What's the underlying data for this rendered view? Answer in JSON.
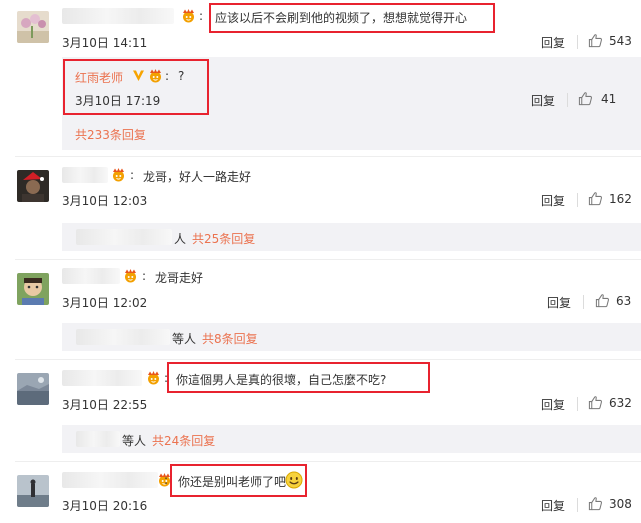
{
  "comments": [
    {
      "text": "应该以后不会刷到他的视频了，想想就觉得开心",
      "date": "3月10日 14:11",
      "reply_label": "回复",
      "likes": "543",
      "replies": [
        {
          "username": "红雨老师",
          "text": "?",
          "date": "3月10日 17:19",
          "reply_label": "回复",
          "likes": "41"
        }
      ],
      "more_replies": "共233条回复"
    },
    {
      "text": "龙哥，好人一路走好",
      "date": "3月10日 12:03",
      "reply_label": "回复",
      "likes": "162",
      "more_prefix": "人",
      "more_replies": "共25条回复"
    },
    {
      "text": "龙哥走好",
      "date": "3月10日 12:02",
      "reply_label": "回复",
      "likes": "63",
      "more_prefix": "等人",
      "more_replies": "共8条回复"
    },
    {
      "text": "你這個男人是真的很壞，自己怎麼不吃?",
      "date": "3月10日 22:55",
      "reply_label": "回复",
      "likes": "632",
      "more_prefix": "等人",
      "more_replies": "共24条回复"
    },
    {
      "text": "你还是别叫老师了吧",
      "emoji": "smile-emoji",
      "date": "3月10日 20:16",
      "reply_label": "回复",
      "likes": "308"
    }
  ],
  "colors": {
    "link": "#eb7350",
    "highlight_frame": "#e8232f",
    "verified_v": "#f7a400",
    "reply_box": "#f2f2f5"
  }
}
